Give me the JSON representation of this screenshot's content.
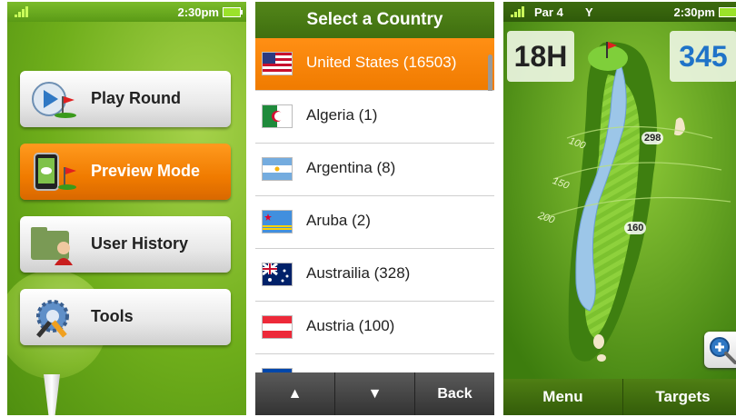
{
  "panel1": {
    "status": {
      "time": "2:30pm"
    },
    "menu": [
      {
        "label": "Play Round",
        "icon": "play-round-icon"
      },
      {
        "label": "Preview Mode",
        "icon": "preview-mode-icon",
        "active": true
      },
      {
        "label": "User History",
        "icon": "user-history-icon"
      },
      {
        "label": "Tools",
        "icon": "tools-icon"
      }
    ]
  },
  "panel2": {
    "title": "Select a Country",
    "countries": [
      {
        "name": "United States (16503)",
        "selected": true,
        "flag": "us-flag-icon"
      },
      {
        "name": "Algeria (1)",
        "flag": "algeria-flag-icon"
      },
      {
        "name": "Argentina (8)",
        "flag": "argentina-flag-icon"
      },
      {
        "name": "Aruba (2)",
        "flag": "aruba-flag-icon"
      },
      {
        "name": "Austrailia (328)",
        "flag": "australia-flag-icon"
      },
      {
        "name": "Austria (100)",
        "flag": "austria-flag-icon"
      }
    ],
    "tabbar": {
      "up": "▲",
      "down": "▼",
      "back": "Back"
    }
  },
  "panel3": {
    "status": {
      "par": "Par 4",
      "tee": "Y",
      "time": "2:30pm"
    },
    "hole": "18H",
    "distance": "345",
    "arcs": [
      "100",
      "150",
      "200"
    ],
    "markers": [
      "298",
      "160"
    ],
    "bottombar": {
      "menu": "Menu",
      "targets": "Targets"
    }
  },
  "colors": {
    "accent": "#f07b00",
    "green": "#6fae1b",
    "distance": "#1f73c8"
  }
}
